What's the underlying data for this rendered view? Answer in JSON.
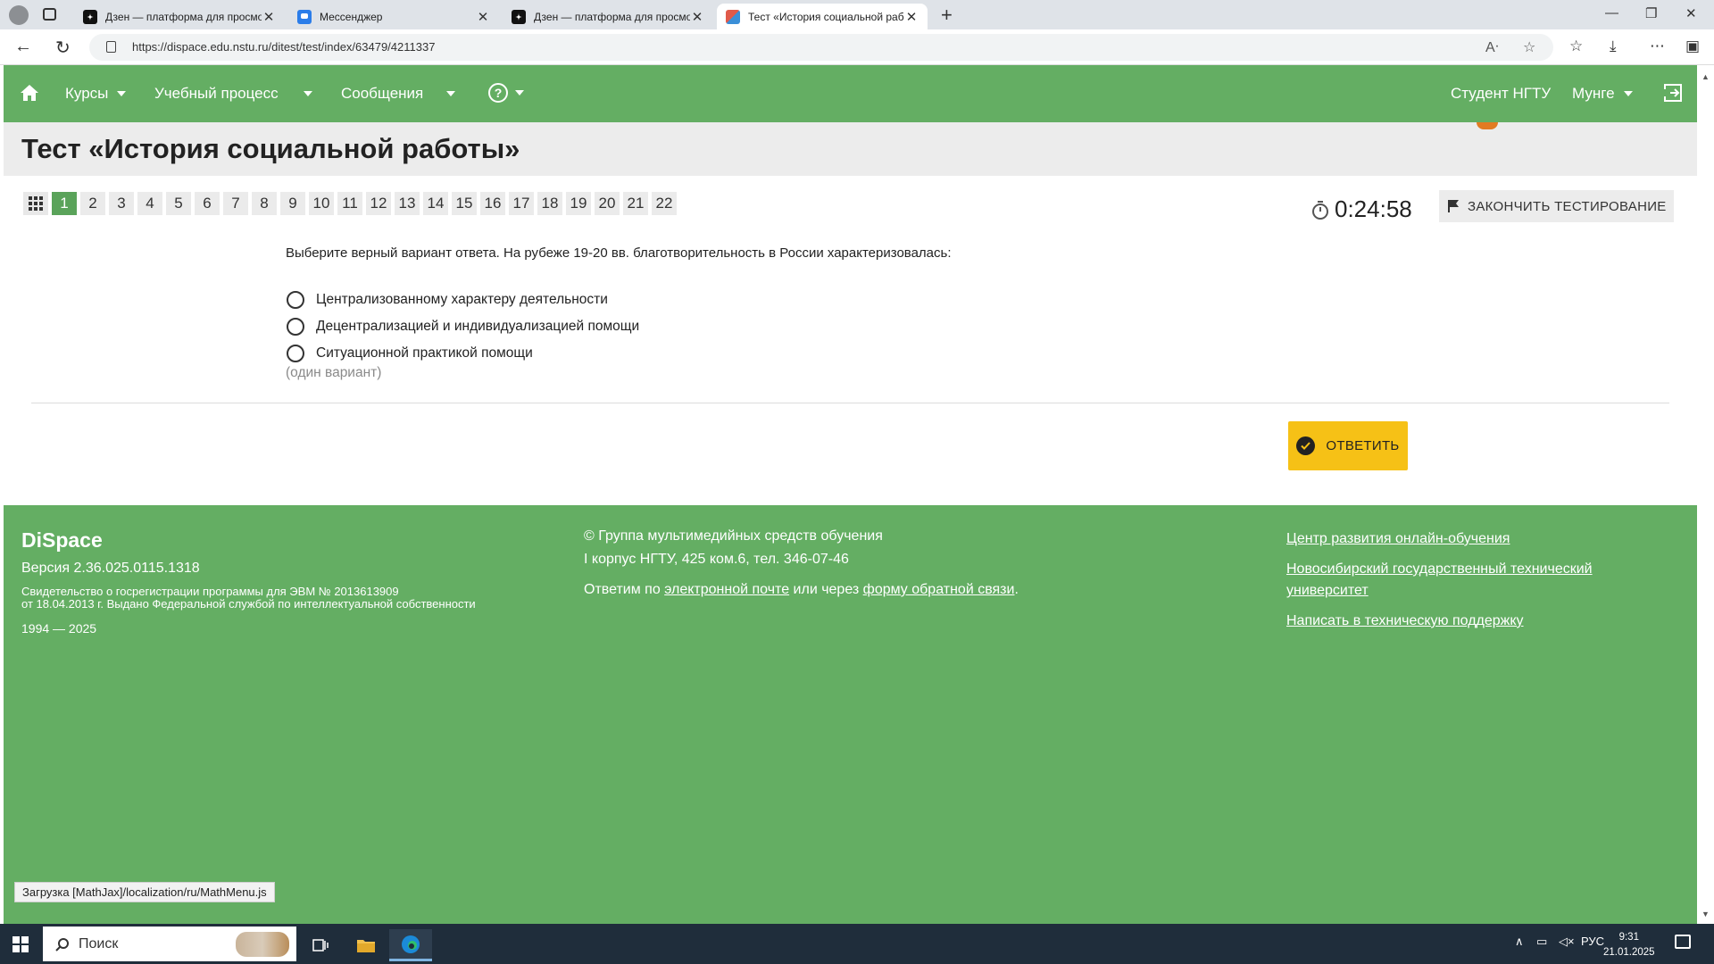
{
  "browser": {
    "tabs": [
      {
        "title": "Дзен — платформа для просмотра",
        "favicon": "dzen-icon",
        "active": false
      },
      {
        "title": "Мессенджер",
        "favicon": "messenger-icon",
        "active": false
      },
      {
        "title": "Дзен — платформа для просмотра",
        "favicon": "dzen-icon",
        "active": false
      },
      {
        "title": "Тест «История социальной работы»",
        "favicon": "dispace-icon",
        "active": true
      }
    ],
    "url": "https://dispace.edu.nstu.ru/ditest/test/index/63479/4211337"
  },
  "navbar": {
    "items": [
      {
        "label": "Курсы",
        "has_dropdown": true
      },
      {
        "label": "Учебный процесс",
        "has_dropdown": true
      },
      {
        "label": "Сообщения",
        "has_dropdown": true
      }
    ],
    "help_label": "?",
    "user_role": "Студент НГТУ",
    "user_name": "Мунге",
    "accent_color": "#64ae63"
  },
  "page": {
    "title": "Тест «История социальной работы»"
  },
  "test": {
    "question_numbers": [
      "1",
      "2",
      "3",
      "4",
      "5",
      "6",
      "7",
      "8",
      "9",
      "10",
      "11",
      "12",
      "13",
      "14",
      "15",
      "16",
      "17",
      "18",
      "19",
      "20",
      "21",
      "22"
    ],
    "current_question": "1",
    "timer": "0:24:58",
    "finish_label": "ЗАКОНЧИТЬ ТЕСТИРОВАНИЕ",
    "question_text": "Выберите верный вариант ответа. На рубеже 19-20 вв. благотворительность в России характеризовалась:",
    "options": [
      "Централизованному характеру деятельности",
      "Децентрализацией и индивидуализацией помощи",
      "Ситуационной практикой помощи"
    ],
    "hint": "(один вариант)",
    "answer_label": "ОТВЕТИТЬ",
    "answer_color": "#f6c116"
  },
  "footer": {
    "brand": "DiSpace",
    "version": "Версия 2.36.025.0115.1318",
    "cert_line1": "Свидетельство о госрегистрации программы для ЭВМ № 2013613909",
    "cert_line2": "от 18.04.2013 г. Выдано Федеральной службой по интеллектуальной собственности",
    "years": "1994 — 2025",
    "group": "© Группа мультимедийных средств обучения",
    "address": "I корпус НГТУ, 425 ком.6, тел. 346-07-46",
    "contact_prefix": "Ответим по ",
    "contact_email_link": "электронной почте",
    "contact_middle": " или через ",
    "contact_form_link": "форму обратной связи",
    "contact_suffix": ".",
    "links": [
      "Центр развития онлайн-обучения",
      "Новосибирский государственный технический университет",
      "Написать в техническую поддержку"
    ]
  },
  "status_bar_text": "Загрузка [MathJax]/localization/ru/MathMenu.js",
  "taskbar": {
    "search_placeholder": "Поиск",
    "language": "РУС",
    "time": "9:31",
    "date": "21.01.2025"
  }
}
